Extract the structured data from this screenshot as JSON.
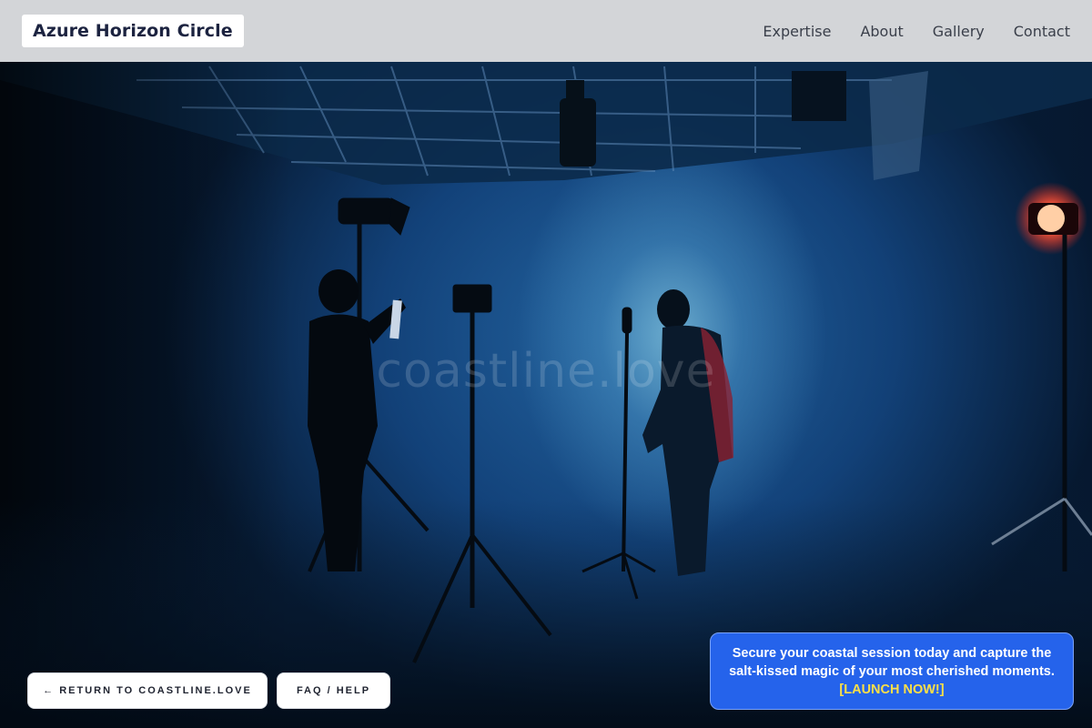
{
  "header": {
    "brand": "Azure Horizon Circle",
    "nav": [
      {
        "label": "Expertise"
      },
      {
        "label": "About"
      },
      {
        "label": "Gallery"
      },
      {
        "label": "Contact"
      }
    ]
  },
  "hero": {
    "watermark": "coastline.love"
  },
  "buttons": {
    "return_label": "← RETURN TO COASTLINE.LOVE",
    "faq_label": "FAQ / HELP"
  },
  "cta": {
    "text": "Secure your coastal session today and capture the salt-kissed magic of your most cherished moments.",
    "link_label": "[LAUNCH NOW!]"
  },
  "colors": {
    "header_bg": "#d3d5d8",
    "brand_text": "#1c2340",
    "cta_bg": "#2563eb",
    "cta_link": "#fde047"
  }
}
